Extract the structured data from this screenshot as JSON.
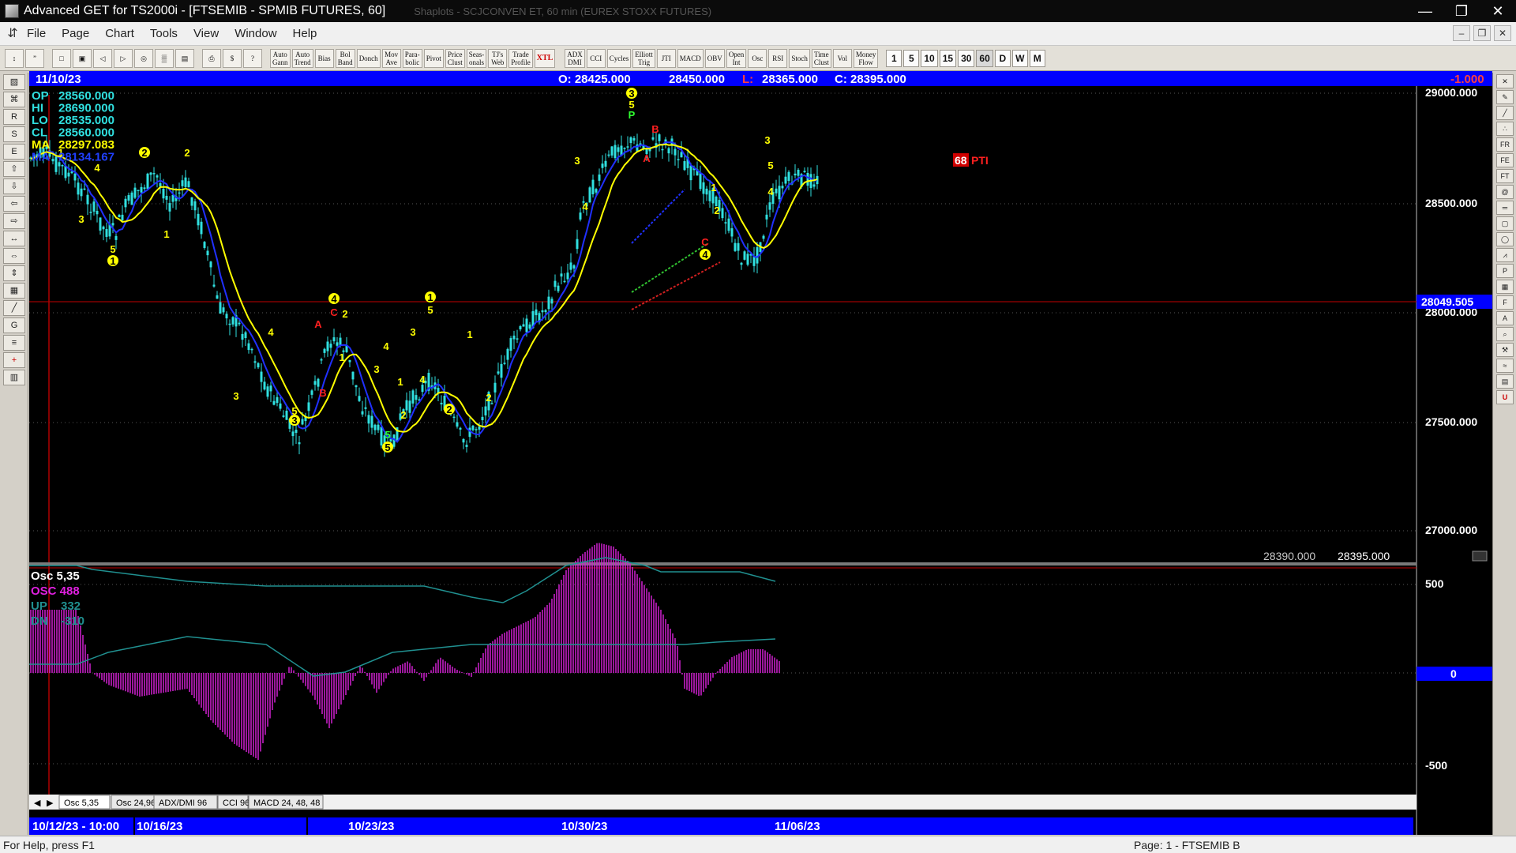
{
  "window": {
    "title": "Advanced GET for TS2000i - [FTSEMIB - SPMIB FUTURES, 60]",
    "ghost_title": "Shaplots - SCJCONVEN  ET, 60 min  (EUREX STOXX FUTURES)",
    "controls": [
      "—",
      "❐",
      "✕"
    ]
  },
  "menu": {
    "items": [
      "File",
      "Page",
      "Chart",
      "Tools",
      "View",
      "Window",
      "Help"
    ],
    "mdi_controls": [
      "–",
      "❐",
      "✕"
    ]
  },
  "toolbar": {
    "indicators": [
      "Auto\nGann",
      "Auto\nTrend",
      "Bias",
      "Bol\nBand",
      "Donch",
      "Mov\nAve",
      "Para-\nbolic",
      "Pivot",
      "Price\nClust",
      "Seas-\nonals",
      "TJ's\nWeb",
      "Trade\nProfile",
      "XTL",
      "ADX\nDMI",
      "CCI",
      "Cycles",
      "Elliott\nTrig",
      "JTI",
      "MACD",
      "OBV",
      "Open\nInt",
      "Osc",
      "RSI",
      "Stoch",
      "Time\nClust",
      "Vol",
      "Money\nFlow"
    ],
    "timeframes": [
      "1",
      "5",
      "10",
      "15",
      "30",
      "60",
      "D",
      "W",
      "M"
    ],
    "active_timeframe": "60"
  },
  "header": {
    "date": "11/10/23",
    "open": "O: 28425.000",
    "high": "28450.000",
    "low_label": "L:",
    "low": "28365.000",
    "close": "C: 28395.000",
    "change": "-1.000"
  },
  "data_box": [
    {
      "label": "OP",
      "value": "28560.000",
      "color": "#30e0e0"
    },
    {
      "label": "HI",
      "value": "28690.000",
      "color": "#30e0e0"
    },
    {
      "label": "LO",
      "value": "28535.000",
      "color": "#30e0e0"
    },
    {
      "label": "CL",
      "value": "28560.000",
      "color": "#30e0e0"
    },
    {
      "label": "MA",
      "value": "28297.083",
      "color": "#ffff00"
    },
    {
      "label": "MA",
      "value": "28134.167",
      "color": "#2040ff"
    }
  ],
  "price_axis": {
    "labels": [
      "29000.000",
      "28500.000",
      "28000.000",
      "27500.000",
      "27000.000"
    ],
    "current_price_tag": "28049.505",
    "bottom_left_value": "28390.000",
    "bottom_right_value": "28395.000"
  },
  "pti": {
    "value": "68",
    "label": "PTI"
  },
  "oscillator": {
    "title": "Osc 5,35",
    "osc": "OSC 488",
    "up_label": "UP",
    "up_value": "332",
    "dn_label": "DN",
    "dn_value": "-310",
    "axis": [
      "500",
      "0",
      "-500"
    ]
  },
  "tabs": [
    "Osc 5,35",
    "Osc 24,96",
    "ADX/DMI 96",
    "CCI 96",
    "MACD 24, 48, 48"
  ],
  "time_axis": {
    "range_start": "10/12/23 - 10:00",
    "dates": [
      "10/16/23",
      "10/23/23",
      "10/30/23",
      "11/06/23"
    ]
  },
  "elliott_labels": [
    {
      "t": "1",
      "c": "#ffff00"
    },
    {
      "t": "4",
      "c": "#ffff00"
    },
    {
      "t": "3",
      "c": "#ffff00"
    },
    {
      "t": "5",
      "c": "#ffff00"
    },
    {
      "t": "1",
      "c": "#ffff00",
      "circle": true
    },
    {
      "t": "2",
      "c": "#ffff00",
      "circle": true
    },
    {
      "t": "1",
      "c": "#ffff00"
    },
    {
      "t": "2",
      "c": "#ffff00"
    },
    {
      "t": "3",
      "c": "#ffff00"
    },
    {
      "t": "4",
      "c": "#ffff00"
    },
    {
      "t": "5",
      "c": "#ffff00"
    },
    {
      "t": "3",
      "c": "#ffff00",
      "circle": true
    },
    {
      "t": "A",
      "c": "#ff2020"
    },
    {
      "t": "4",
      "c": "#ffff00",
      "circle": true
    },
    {
      "t": "C",
      "c": "#ff2020"
    },
    {
      "t": "2",
      "c": "#ffff00"
    },
    {
      "t": "B",
      "c": "#ff2020"
    },
    {
      "t": "1",
      "c": "#ffff00"
    },
    {
      "t": "3",
      "c": "#ffff00"
    },
    {
      "t": "4",
      "c": "#ffff00"
    },
    {
      "t": "1",
      "c": "#ffff00"
    },
    {
      "t": "2",
      "c": "#ffff00"
    },
    {
      "t": "5",
      "c": "#30ff30"
    },
    {
      "t": "5",
      "c": "#ffff00",
      "circle": true
    },
    {
      "t": "3",
      "c": "#ffff00"
    },
    {
      "t": "1",
      "c": "#ffff00",
      "circle": true
    },
    {
      "t": "5",
      "c": "#ffff00"
    },
    {
      "t": "4",
      "c": "#ffff00"
    },
    {
      "t": "2",
      "c": "#ffff00",
      "circle": true
    },
    {
      "t": "1",
      "c": "#ffff00"
    },
    {
      "t": "2",
      "c": "#ffff00"
    },
    {
      "t": "3",
      "c": "#ffff00"
    },
    {
      "t": "4",
      "c": "#ffff00"
    },
    {
      "t": "3",
      "c": "#ffff00",
      "circle": true
    },
    {
      "t": "5",
      "c": "#ffff00"
    },
    {
      "t": "P",
      "c": "#30ff30"
    },
    {
      "t": "B",
      "c": "#ff2020"
    },
    {
      "t": "A",
      "c": "#ff2020"
    },
    {
      "t": "1",
      "c": "#ffff00"
    },
    {
      "t": "2",
      "c": "#ffff00"
    },
    {
      "t": "C",
      "c": "#ff2020"
    },
    {
      "t": "4",
      "c": "#ffff00",
      "circle": true
    },
    {
      "t": "3",
      "c": "#ffff00"
    },
    {
      "t": "5",
      "c": "#ffff00"
    },
    {
      "t": "4",
      "c": "#ffff00"
    }
  ],
  "status": {
    "help": "For Help, press F1",
    "page": "Page: 1 - FTSEMIB B"
  },
  "colors": {
    "candle": "#30e0e0",
    "ma_fast": "#ffff00",
    "ma_slow": "#2030ff",
    "hist": "#d020d0",
    "osc_band": "#209090",
    "header_bar": "#0000ff",
    "red_line": "#c00000"
  }
}
